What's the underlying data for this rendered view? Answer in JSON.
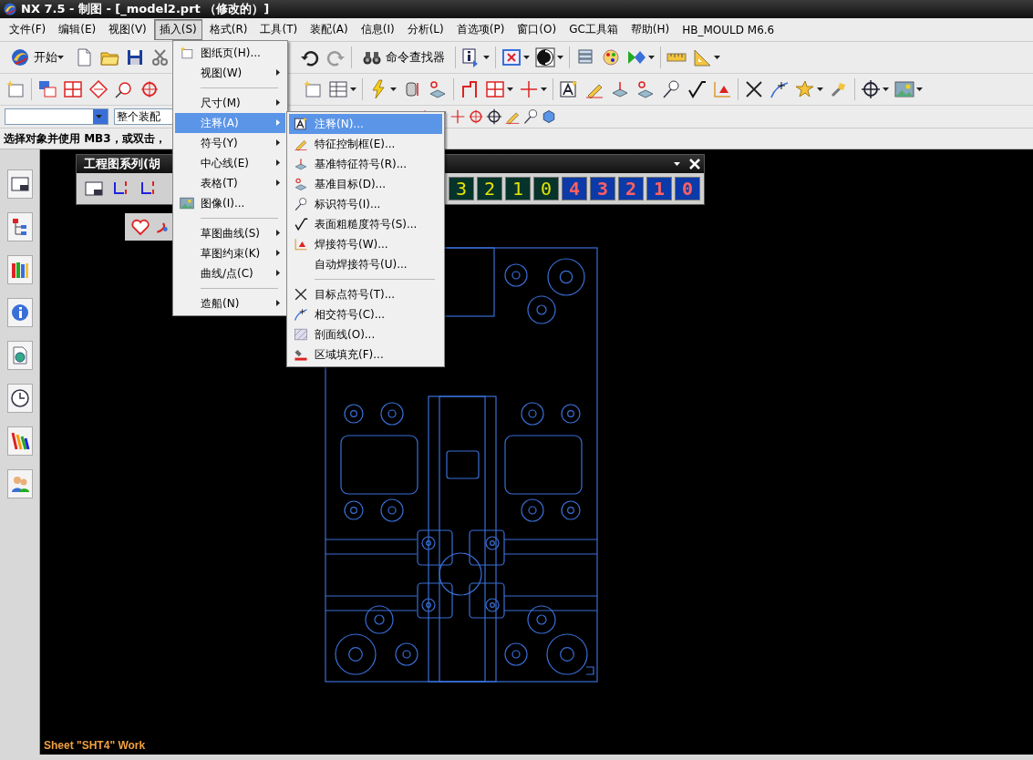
{
  "window": {
    "title": "NX 7.5 - 制图 - [_model2.prt （修改的）]"
  },
  "menubar": [
    {
      "label": "文件(F)",
      "selected": false
    },
    {
      "label": "编辑(E)",
      "selected": false
    },
    {
      "label": "视图(V)",
      "selected": false
    },
    {
      "label": "插入(S)",
      "selected": true
    },
    {
      "label": "格式(R)",
      "selected": false
    },
    {
      "label": "工具(T)",
      "selected": false
    },
    {
      "label": "装配(A)",
      "selected": false
    },
    {
      "label": "信息(I)",
      "selected": false
    },
    {
      "label": "分析(L)",
      "selected": false
    },
    {
      "label": "首选项(P)",
      "selected": false
    },
    {
      "label": "窗口(O)",
      "selected": false
    },
    {
      "label": "GC工具箱",
      "selected": false
    },
    {
      "label": "帮助(H)",
      "selected": false
    },
    {
      "label": "HB_MOULD M6.6",
      "selected": false
    }
  ],
  "toolbar": {
    "start_button": "开始",
    "command_finder": "命令查找器"
  },
  "selection_bar": {
    "scope": "整个装配"
  },
  "prompt": "选择对象并使用 MB3，或双击，",
  "insert_menu": [
    {
      "label": "图纸页(H)...",
      "kind": "command",
      "selected": false
    },
    {
      "label": "视图(W)",
      "kind": "submenu",
      "selected": false
    },
    {
      "kind": "separator"
    },
    {
      "label": "尺寸(M)",
      "kind": "submenu",
      "selected": false
    },
    {
      "label": "注释(A)",
      "kind": "submenu",
      "selected": true
    },
    {
      "label": "符号(Y)",
      "kind": "submenu",
      "selected": false
    },
    {
      "label": "中心线(E)",
      "kind": "submenu",
      "selected": false
    },
    {
      "label": "表格(T)",
      "kind": "submenu",
      "selected": false
    },
    {
      "label": "图像(I)...",
      "kind": "command",
      "selected": false
    },
    {
      "kind": "separator"
    },
    {
      "label": "草图曲线(S)",
      "kind": "submenu",
      "selected": false
    },
    {
      "label": "草图约束(K)",
      "kind": "submenu",
      "selected": false
    },
    {
      "label": "曲线/点(C)",
      "kind": "submenu",
      "selected": false
    },
    {
      "kind": "separator"
    },
    {
      "label": "造船(N)",
      "kind": "submenu",
      "selected": false
    }
  ],
  "annotation_submenu": [
    {
      "label": "注释(N)...",
      "kind": "command",
      "selected": true
    },
    {
      "label": "特征控制框(E)...",
      "kind": "command",
      "selected": false
    },
    {
      "label": "基准特征符号(R)...",
      "kind": "command",
      "selected": false
    },
    {
      "label": "基准目标(D)...",
      "kind": "command",
      "selected": false
    },
    {
      "label": "标识符号(I)...",
      "kind": "command",
      "selected": false
    },
    {
      "label": "表面粗糙度符号(S)...",
      "kind": "command",
      "selected": false
    },
    {
      "label": "焊接符号(W)...",
      "kind": "command",
      "selected": false
    },
    {
      "label": "自动焊接符号(U)...",
      "kind": "command",
      "selected": false
    },
    {
      "kind": "separator"
    },
    {
      "label": "目标点符号(T)...",
      "kind": "command",
      "selected": false
    },
    {
      "label": "相交符号(C)...",
      "kind": "command",
      "selected": false
    },
    {
      "label": "剖面线(O)...",
      "kind": "command",
      "selected": false
    },
    {
      "label": "区域填充(F)...",
      "kind": "command",
      "selected": false
    }
  ],
  "floating_toolbar": {
    "title": "工程图系列(胡",
    "buttons": [
      {
        "label": "3",
        "kind": "green"
      },
      {
        "label": "2",
        "kind": "green"
      },
      {
        "label": "1",
        "kind": "green"
      },
      {
        "label": "0",
        "kind": "green"
      },
      {
        "label": "4",
        "kind": "blue"
      },
      {
        "label": "3",
        "kind": "blue"
      },
      {
        "label": "2",
        "kind": "blue"
      },
      {
        "label": "1",
        "kind": "blue"
      },
      {
        "label": "0",
        "kind": "blue"
      }
    ]
  },
  "sheet_status": "Sheet \"SHT4\" Work"
}
